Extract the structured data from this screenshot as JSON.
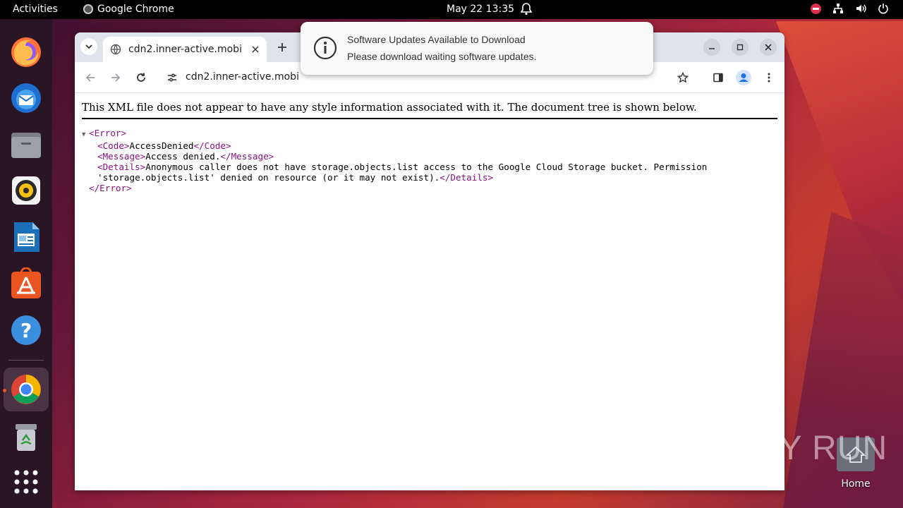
{
  "topbar": {
    "activities": "Activities",
    "app_name": "Google Chrome",
    "clock": "May 22  13:35"
  },
  "dock": {
    "items": [
      "firefox-icon",
      "thunderbird-icon",
      "files-icon",
      "rhythmbox-icon",
      "libreoffice-writer-icon",
      "app-center-icon",
      "help-icon",
      "chrome-icon",
      "trash-icon",
      "show-apps-icon"
    ]
  },
  "browser": {
    "tab_title": "cdn2.inner-active.mobi",
    "url": "cdn2.inner-active.mobi"
  },
  "page": {
    "notice": "This XML file does not appear to have any style information associated with it. The document tree is shown below.",
    "xml": {
      "error_open": "<Error>",
      "code_open": "<Code>",
      "code_value": "AccessDenied",
      "code_close": "</Code>",
      "message_open": "<Message>",
      "message_value": "Access denied.",
      "message_close": "</Message>",
      "details_open": "<Details>",
      "details_value_1": "Anonymous caller does not have storage.objects.list access to the Google Cloud Storage bucket. Permission",
      "details_value_2": "'storage.objects.list' denied on resource (or it may not exist).",
      "details_close": "</Details>",
      "error_close": "</Error>"
    }
  },
  "notification": {
    "title": "Software Updates Available to Download",
    "body": "Please download waiting software updates."
  },
  "desktop": {
    "home_label": "Home",
    "watermark": "ANY RUN"
  },
  "colors": {
    "accent": "#e95420",
    "xml_tag": "#881280"
  }
}
